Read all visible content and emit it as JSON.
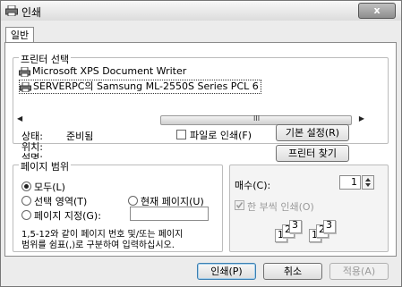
{
  "window": {
    "title": "인쇄",
    "close_label": "x"
  },
  "tabs": [
    {
      "label": "일반"
    }
  ],
  "printer_select": {
    "group_label": "프린터 선택",
    "printers": [
      {
        "name": "Microsoft XPS Document Writer",
        "selected": false
      },
      {
        "name": "SERVERPC의 Samsung ML-2550S Series PCL 6",
        "selected": true
      }
    ],
    "scroll_grip": "III",
    "status_label": "상태:",
    "status_value": "준비됨",
    "location_label": "위치:",
    "comment_label": "설명:",
    "print_to_file_label": "파일로 인쇄(F)",
    "print_to_file_checked": false,
    "preferences_button": "기본 설정(R)",
    "find_printer_button": "프린터 찾기(D)..."
  },
  "page_range": {
    "group_label": "페이지 범위",
    "all_label": "모두(L)",
    "selection_label": "선택 영역(T)",
    "current_page_label": "현재 페이지(U)",
    "pages_label": "페이지 지정(G):",
    "pages_value": "",
    "selected": "all",
    "help_line1": "1,5-12와 같이 페이지 번호 및/또는 페이지",
    "help_line2": "범위를 쉼표(,)로 구분하여 입력하십시오."
  },
  "copies": {
    "label": "매수(C):",
    "value": "1",
    "collate_label": "한 부씩 인쇄(O)",
    "collate_checked": true,
    "collate_enabled": false,
    "collate_digits": [
      "1",
      "2",
      "3",
      "1",
      "2",
      "3"
    ]
  },
  "footer": {
    "print_button": "인쇄(P)",
    "cancel_button": "취소",
    "apply_button": "적용(A)"
  },
  "colors": {
    "window_bg": "#ececec",
    "panel_bg": "#ffffff",
    "disabled_text": "#9a9a9a"
  }
}
